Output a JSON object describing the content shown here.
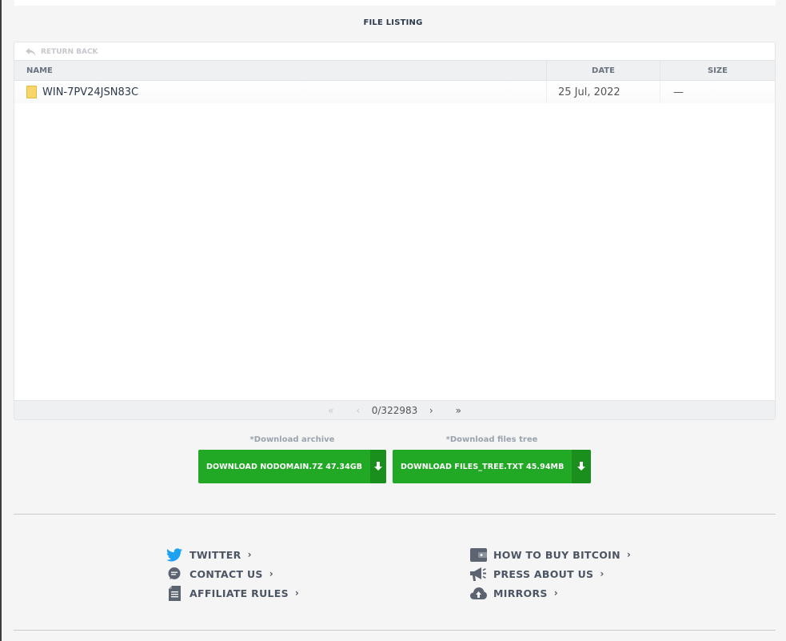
{
  "listing": {
    "title": "FILE LISTING",
    "return_back": "RETURN BACK",
    "columns": {
      "name": "NAME",
      "date": "DATE",
      "size": "SIZE"
    },
    "rows": [
      {
        "name": "WIN-7PV24JSN83C",
        "date": "25 Jul, 2022",
        "size": "—"
      }
    ],
    "pager": {
      "first": "«",
      "prev": "‹",
      "info": "0/322983",
      "next": "›",
      "last": "»"
    }
  },
  "downloads": {
    "archive": {
      "note": "*Download archive",
      "label": "DOWNLOAD NODOMAIN.7Z 47.34GB"
    },
    "tree": {
      "note": "*Download files tree",
      "label": "DOWNLOAD FILES_TREE.TXT 45.94MB"
    }
  },
  "footer": {
    "left": [
      {
        "icon": "twitter-icon",
        "label": "TWITTER"
      },
      {
        "icon": "chat-icon",
        "label": "CONTACT US"
      },
      {
        "icon": "document-icon",
        "label": "AFFILIATE RULES"
      }
    ],
    "right": [
      {
        "icon": "wallet-icon",
        "label": "HOW TO BUY BITCOIN"
      },
      {
        "icon": "megaphone-icon",
        "label": "PRESS ABOUT US"
      },
      {
        "icon": "cloud-upload-icon",
        "label": "MIRRORS"
      }
    ],
    "chevron": "›"
  },
  "colors": {
    "accent_green": "#21a825",
    "accent_green_dark": "#1b8f1e",
    "twitter_blue": "#1da1f2",
    "folder_yellow": "#f7d56a"
  }
}
